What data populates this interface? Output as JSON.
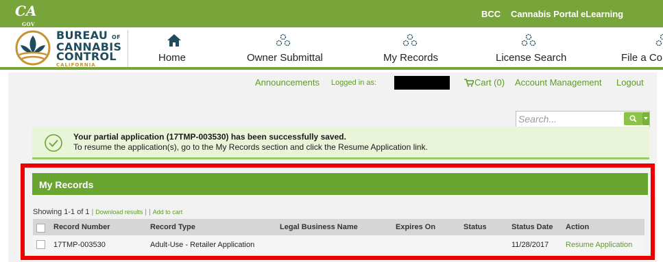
{
  "top_bar": {
    "ca_logo_text": "CA",
    "ca_logo_sub": "GOV",
    "links": [
      "BCC",
      "Cannabis Portal",
      "eLearning"
    ]
  },
  "logo": {
    "line1": "BUREAU",
    "line1_suffix": "OF",
    "line2": "CANNABIS",
    "line3": "CONTROL",
    "line4": "CALIFORNIA"
  },
  "nav": {
    "items": [
      {
        "label": "Home",
        "icon": "home-icon"
      },
      {
        "label": "Owner Submittal",
        "icon": "gears-icon"
      },
      {
        "label": "My Records",
        "icon": "gears-icon"
      },
      {
        "label": "License Search",
        "icon": "gears-icon"
      },
      {
        "label": "File a Co",
        "icon": "gears-icon"
      }
    ]
  },
  "util": {
    "announcements": "Announcements",
    "logged_in_label": "Logged in as:",
    "cart": "Cart (0)",
    "account": "Account Management",
    "logout": "Logout"
  },
  "search": {
    "placeholder": "Search..."
  },
  "notice": {
    "title": "Your partial application (17TMP-003530) has been successfully saved.",
    "body": "To resume the application(s), go to the My Records section and click the Resume Application link."
  },
  "records": {
    "title": "My Records",
    "showing": "Showing 1-1 of 1",
    "download": "Download results",
    "add_to_cart": "Add to cart",
    "columns": [
      "Record Number",
      "Record Type",
      "Legal Business Name",
      "Expires On",
      "Status",
      "Status Date",
      "Action"
    ],
    "rows": [
      {
        "record_number": "17TMP-003530",
        "record_type": "Adult-Use - Retailer Application",
        "legal_business_name": "",
        "expires_on": "",
        "status": "",
        "status_date": "11/28/2017",
        "action": "Resume Application"
      }
    ]
  },
  "colors": {
    "brand_green": "#77a53a",
    "link_green": "#5e9a28",
    "highlight_red": "#ee0000",
    "logo_navy": "#1e4c5e",
    "logo_gold": "#c79231"
  }
}
